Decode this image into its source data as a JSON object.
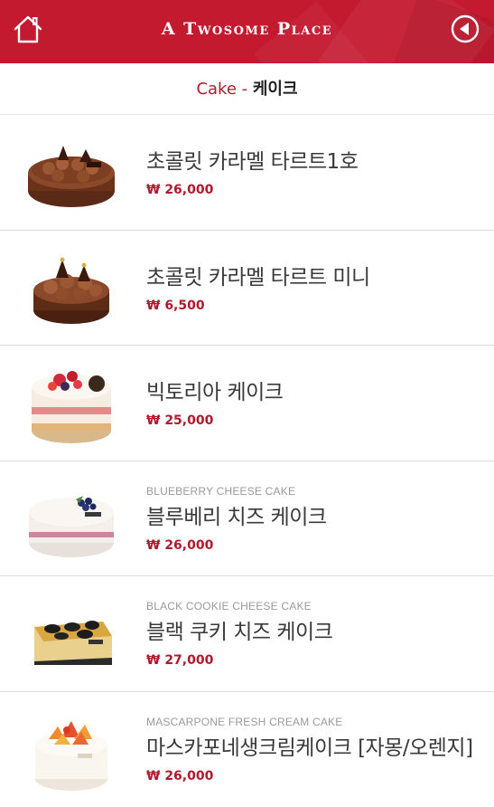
{
  "header": {
    "brand": "A Twosome Place",
    "home_icon": "home-icon",
    "back_icon": "back-arrow-icon",
    "color": "#c41a30"
  },
  "subheader": {
    "category_en": "Cake",
    "separator": " - ",
    "category_ko": "케이크"
  },
  "products": [
    {
      "eng": "",
      "name": "초콜릿 카라멜 타르트1호",
      "price": "₩ 26,000",
      "image": "chocolate-caramel-tart"
    },
    {
      "eng": "",
      "name": "초콜릿 카라멜 타르트 미니",
      "price": "₩ 6,500",
      "image": "chocolate-caramel-tart-mini"
    },
    {
      "eng": "",
      "name": "빅토리아 케이크",
      "price": "₩ 25,000",
      "image": "victoria-cake"
    },
    {
      "eng": "BLUEBERRY CHEESE CAKE",
      "name": "블루베리 치즈 케이크",
      "price": "₩ 26,000",
      "image": "blueberry-cheese-cake"
    },
    {
      "eng": "BLACK COOKIE CHEESE CAKE",
      "name": "블랙 쿠키 치즈 케이크",
      "price": "₩ 27,000",
      "image": "black-cookie-cheese-cake"
    },
    {
      "eng": "MASCARPONE FRESH CREAM CAKE",
      "name": "마스카포네생크림케이크 [자몽/오렌지]",
      "price": "₩ 26,000",
      "image": "mascarpone-fresh-cream-cake"
    }
  ]
}
